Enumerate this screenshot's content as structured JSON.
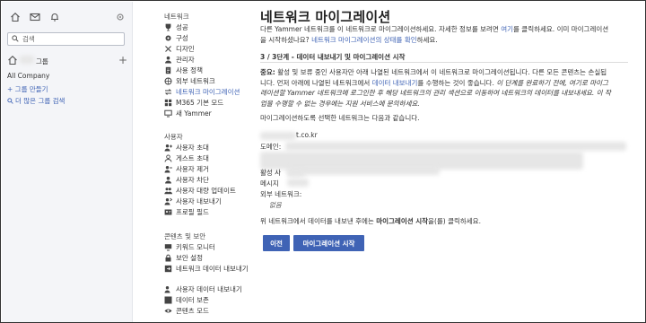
{
  "rail": {
    "search_placeholder": "검색",
    "groups_label": "그룹",
    "add_symbol": "+",
    "all_company": "All Company",
    "create_group": "+ 그룹 만들기",
    "find_more_groups": "더 많은 그룹 검색"
  },
  "nav": {
    "network_section": "네트워크",
    "network_items": [
      {
        "label": "성공",
        "icon": "trophy-icon"
      },
      {
        "label": "구성",
        "icon": "gear-icon"
      },
      {
        "label": "디자인",
        "icon": "scissors-icon"
      },
      {
        "label": "관리자",
        "icon": "user-icon"
      },
      {
        "label": "사용 정책",
        "icon": "document-icon"
      },
      {
        "label": "외부 네트워크",
        "icon": "globe-icon"
      },
      {
        "label": "네트워크 마이그레이션",
        "icon": "arrows-icon"
      },
      {
        "label": "M365 기본 모드",
        "icon": "grid-icon"
      },
      {
        "label": "새 Yammer",
        "icon": "monitor-icon"
      }
    ],
    "users_section": "사용자",
    "user_items": [
      {
        "label": "사용자 초대",
        "icon": "user-plus-icon"
      },
      {
        "label": "게스트 초대",
        "icon": "guest-icon"
      },
      {
        "label": "사용자 제거",
        "icon": "user-remove-icon"
      },
      {
        "label": "사용자 차단",
        "icon": "user-block-icon"
      },
      {
        "label": "사용자 대량 업데이트",
        "icon": "users-icon"
      },
      {
        "label": "사용자 내보내기",
        "icon": "user-export-icon"
      },
      {
        "label": "프로필 필드",
        "icon": "profile-card-icon"
      }
    ],
    "security_section": "콘텐츠 및 보안",
    "security_items": [
      {
        "label": "키워드 모니터",
        "icon": "monitor-icon"
      },
      {
        "label": "보안 설정",
        "icon": "lock-icon"
      },
      {
        "label": "네트워크 데이터 내보내기",
        "icon": "export-icon",
        "wrap": true
      },
      {
        "label": "사용자 데이터 내보내기",
        "icon": "user-export-icon"
      },
      {
        "label": "데이터 보존",
        "icon": "archive-icon"
      },
      {
        "label": "콘텐츠 모드",
        "icon": "eye-icon"
      }
    ]
  },
  "main": {
    "title": "네트워크 마이그레이션",
    "intro_1": "다른 Yammer 네트워크를 이 네트워크로 마이그레이션하세요. 자세한 정보를 보려면 ",
    "intro_link": "여기",
    "intro_2": "를 클릭하세요. 이미 마이그레이션",
    "intro_3": "을 시작하셨나요? ",
    "intro_status_link": "네트워크 마이그레이션의 상태를 확인",
    "intro_4": "하세요.",
    "step_title": "3 / 3단계 - 데이터 내보내기 및 마이그레이션 시작",
    "important_label": "중요:",
    "important_1": " 활성 및 보류 중인 사용자만 아래 나열된 네트워크에서 이 네트워크로 마이그레이션됩니다. 다른 모든 콘텐츠는 손실됩",
    "important_2": "니다. 먼저 아래에 나열된 네트워크에서 ",
    "export_link": "데이터 내보내기",
    "important_3": "를 수행하는 것이 좋습니다. ",
    "important_italic_1": "이 단계를 완료하기 전에, 여기로 마이그",
    "important_italic_2": "레이션할 Yammer 네트워크에 로그인한 후 해당 네트워크의 관리 섹션으로 이동하여 네트워크의 데이터를 내보내세요. 이 작",
    "important_italic_3": "업을 수행할 수 없는 경우에는 지원 서비스에 문의하세요.",
    "selected_networks": "마이그레이션하도록 선택한 네트워크는 다음과 같습니다.",
    "network_domain_fragment": "t.co.kr",
    "field_domain": "도메인:",
    "field_active": "활성 사",
    "field_message": "메시지",
    "field_external": "외부 네트워크:",
    "field_external_value": "없음",
    "final_1": "위 네트워크에서 데이터를 내보낸 후에는 ",
    "final_bold": "마이그레이션 시작",
    "final_2": "을(를) 클릭하세요.",
    "btn_prev": "이전",
    "btn_start": "마이그레이션 시작"
  },
  "colors": {
    "accent": "#3f63b5",
    "rail_bg": "#f4f5f8"
  }
}
